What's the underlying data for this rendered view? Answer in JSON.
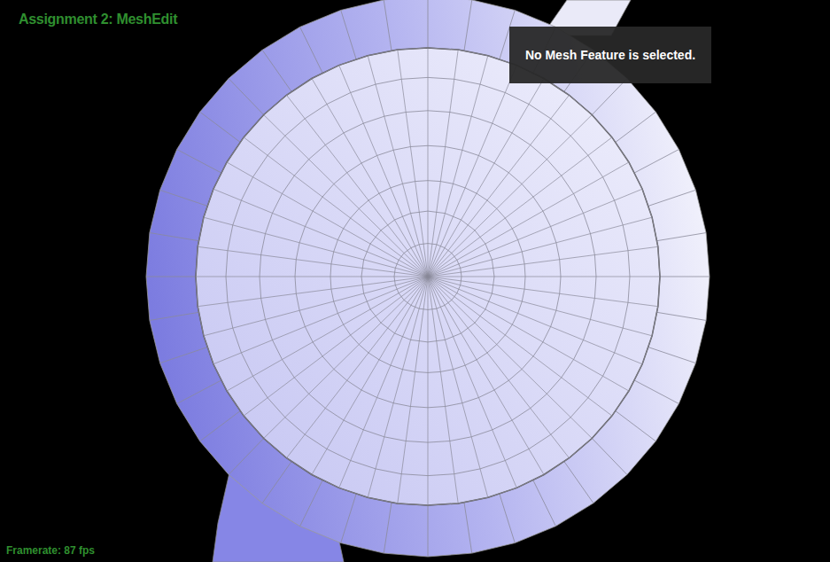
{
  "window": {
    "title": "Assignment 2: MeshEdit"
  },
  "info_panel": {
    "text": "No Mesh Feature is selected."
  },
  "status_bar": {
    "framerate": "Framerate: 87 fps"
  }
}
